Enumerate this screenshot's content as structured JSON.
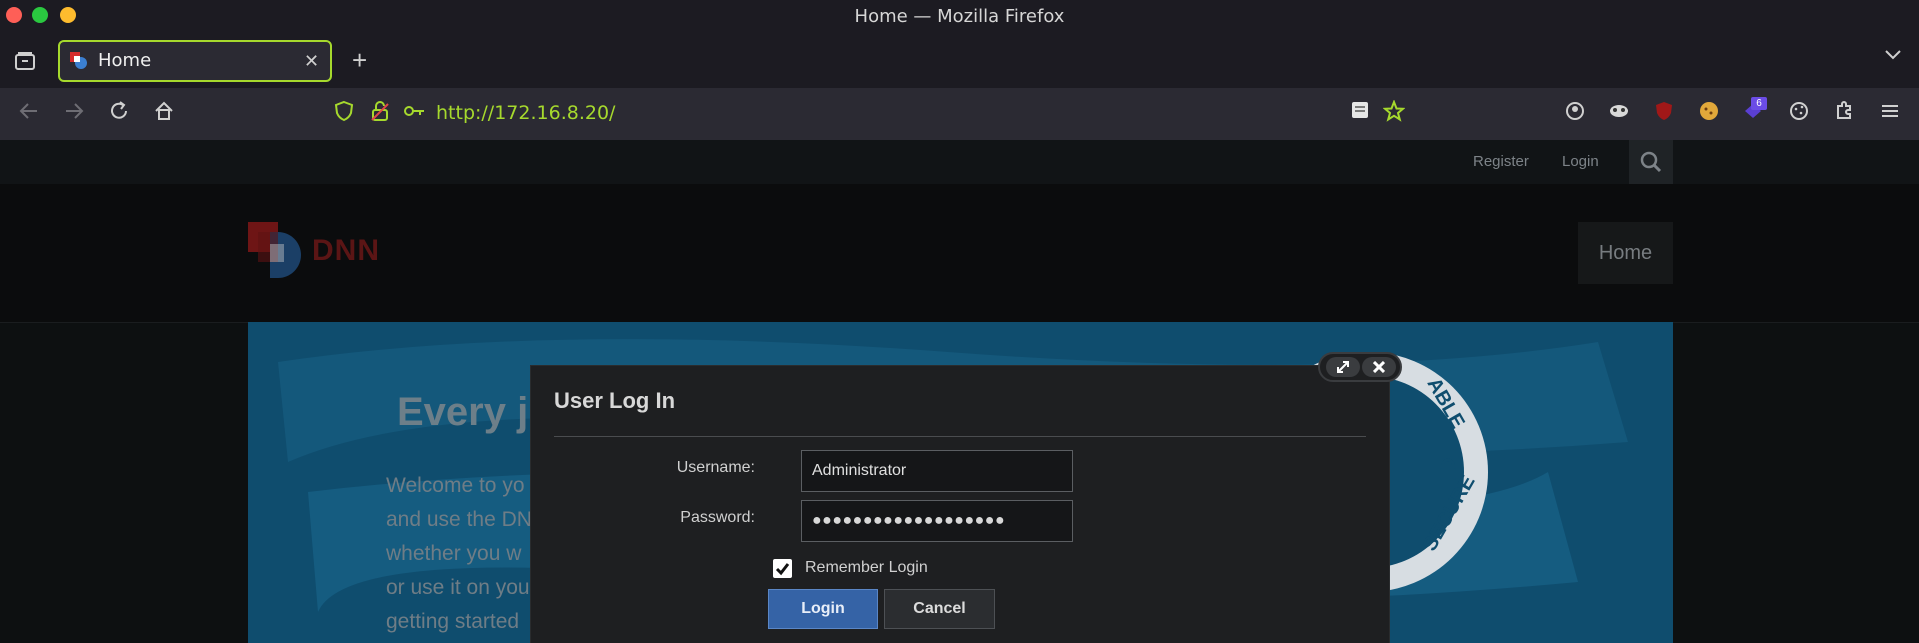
{
  "window": {
    "title": "Home — Mozilla Firefox"
  },
  "tab": {
    "label": "Home",
    "close": "✕"
  },
  "tabbar": {
    "new_tab": "+",
    "list_all": "⌄"
  },
  "navbar": {
    "url_scheme": "http://",
    "url_host": "172.16.8.20",
    "url_path": "/",
    "extension_badge": "6"
  },
  "site": {
    "register": "Register",
    "login": "Login",
    "logo_text": "DNN",
    "nav_home": "Home",
    "hero_title": "Every j",
    "hero_lines": [
      "Welcome to yo",
      "and use the DN",
      "whether you w",
      "or use it on you",
      "getting started"
    ],
    "badge_text_top": "ABLE",
    "badge_text_bottom": "SECURE"
  },
  "modal": {
    "title": "User Log In",
    "username_label": "Username:",
    "username_value": "Administrator",
    "password_label": "Password:",
    "password_value": "●●●●●●●●●●●●●●●●●●●",
    "remember_label": "Remember Login",
    "login_button": "Login",
    "cancel_button": "Cancel"
  },
  "colors": {
    "accent": "#a6d92d",
    "login_button": "#3563a6",
    "hero": "#0f4d6e"
  }
}
